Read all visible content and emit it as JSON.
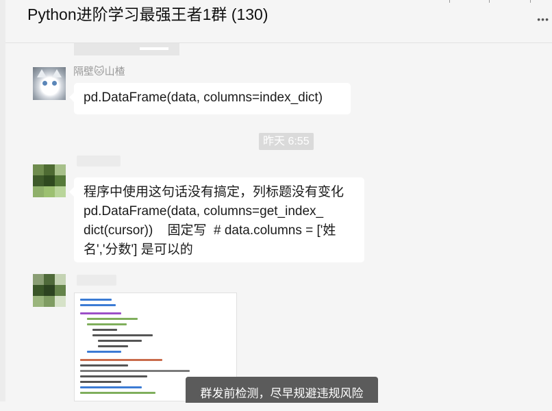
{
  "header": {
    "title": "Python进阶学习最强王者1群 (130)",
    "more_label": "•••"
  },
  "messages": [
    {
      "sender": "隔壁🐱山楂",
      "avatar": "cat-photo-avatar",
      "text": "pd.DataFrame(data, columns=index_dict)"
    },
    {
      "time": "昨天 6:55"
    },
    {
      "sender": "",
      "avatar": "pixelated-avatar",
      "text": "程序中使用这句话没有搞定，列标题没有变化\npd.DataFrame(data, columns=get_index_\ndict(cursor))    固定写  # data.columns = ['姓\n名','分数'] 是可以的"
    },
    {
      "sender": "",
      "avatar": "pixelated-avatar",
      "image": "code-screenshot"
    }
  ],
  "toast": {
    "text": "群发前检测，尽早规避违规风险"
  },
  "colors": {
    "background": "#f5f5f5",
    "bubble": "#ffffff",
    "toast": "#5b5b5b",
    "time_chip": "#dadada"
  }
}
